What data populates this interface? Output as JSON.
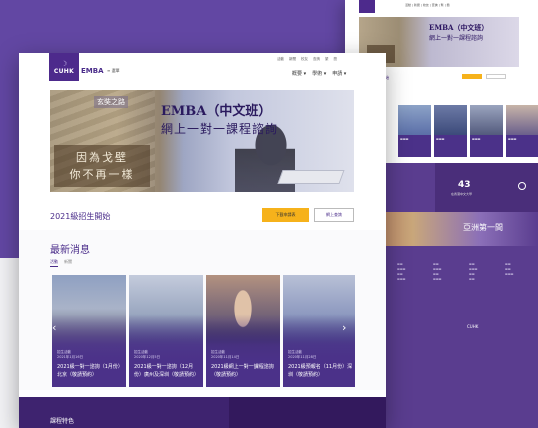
{
  "back_page": {
    "top_links": "活動 | 新聞 | 校友 | 查詢 | 繁 | 簡",
    "hero_title": "EMBA（中文班）",
    "hero_subtitle": "網上一對一課程諮詢",
    "enroll_label": "2021級招生開始",
    "stat_number": "43",
    "stat_label": "在香港中文大學",
    "banner_text": "亞洲第一間",
    "footer_logo": "CUHK"
  },
  "front_page": {
    "logo_mark": "☽",
    "logo_text": "CUHK",
    "emba_logo": "EMBA",
    "menu_link": "≡ 選單",
    "top_links": [
      "活動",
      "新聞",
      "校友",
      "查詢",
      "繁",
      "簡"
    ],
    "main_nav": [
      "概要 ▾",
      "學術 ▾",
      "申請 ▾"
    ],
    "hero": {
      "logo_overlay": "玄奘之路",
      "title": "EMBA（中文班）",
      "subtitle": "網上一對一課程諮詢",
      "line1": "因為戈壁",
      "line2": "你不再一樣"
    },
    "enroll_label": "2021級招生開始",
    "download_button": "下載申請表",
    "consult_button": "網上查詢",
    "news": {
      "heading": "最新消息",
      "tabs": [
        "活動",
        "新聞"
      ],
      "prev_arrow": "‹",
      "next_arrow": "›",
      "cards": [
        {
          "category": "招生活動",
          "date": "2021年1月16日",
          "title": "2021級一對一諮詢（1月份）北京（敬請預約）"
        },
        {
          "category": "招生活動",
          "date": "2020年12月5日",
          "title": "2021級一對一諮詢（12月份）廣州及深圳（敬請預約）"
        },
        {
          "category": "招生活動",
          "date": "2020年11月14日",
          "title": "2021級網上一對一課程諮詢（敬請預約）"
        },
        {
          "category": "招生活動",
          "date": "2020年11月28日",
          "title": "2021級預報名（11月份）深圳（敬請預約）"
        }
      ]
    },
    "features_title": "課程特色"
  },
  "colors": {
    "brand_purple": "#4d2a8c",
    "background_purple": "#6247a3",
    "accent_yellow": "#f6b21b"
  }
}
